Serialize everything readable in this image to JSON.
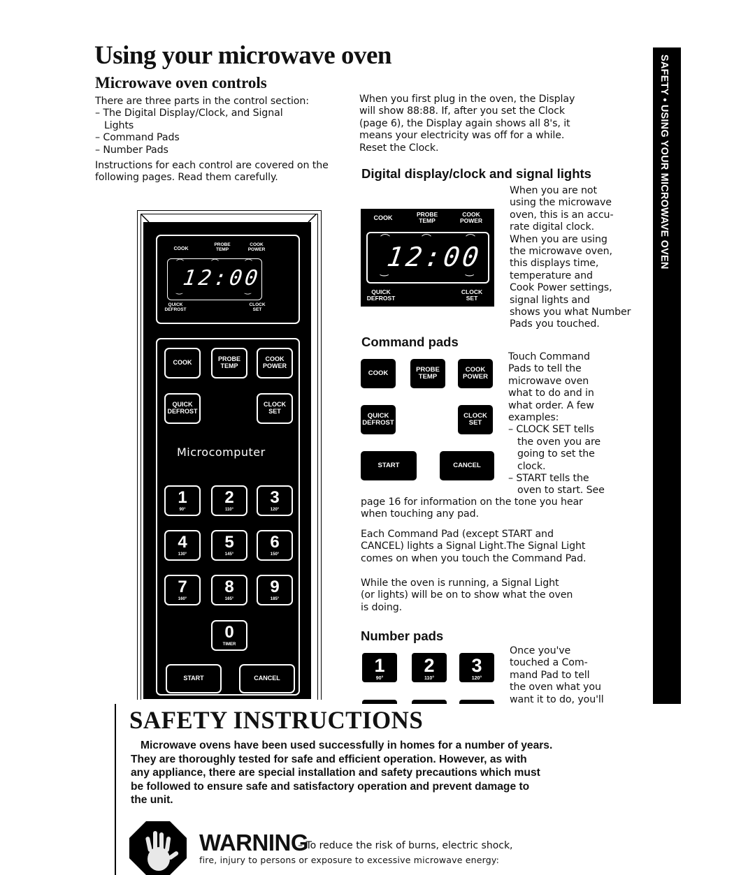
{
  "page": {
    "title": "Using your microwave oven",
    "subtitle": "Microwave oven controls",
    "side_banner": "SAFETY • USING YOUR MICROWAVE OVEN"
  },
  "intro": {
    "lead": "There are three parts in the control section:",
    "items": [
      "– The Digital Display/Clock, and Signal",
      "Lights",
      "– Command Pads",
      "– Number Pads"
    ],
    "instructions": [
      "Instructions for each control are covered on the",
      "following pages. Read them carefully."
    ]
  },
  "plug_text": [
    "When you first plug in the oven, the Display",
    "will show 88:88. If, after you set the Clock",
    "(page 6), the Display again shows all 8's, it",
    "means your electricity was off for a while.",
    "Reset the Clock."
  ],
  "digital_section": {
    "heading": "Digital display/clock and signal lights",
    "text": [
      "When you are not",
      "using the microwave",
      "oven, this is an accu-",
      "rate digital clock.",
      "When you are using",
      "the microwave oven,",
      "this displays time,",
      "temperature and",
      "Cook Power settings,",
      "signal lights and",
      "shows you what Number",
      "Pads you touched."
    ]
  },
  "display": {
    "top_labels": [
      "COOK",
      "PROBE TEMP",
      "COOK POWER"
    ],
    "bottom_labels": [
      "QUICK DEFROST",
      "CLOCK SET"
    ],
    "time": "12:00"
  },
  "command_section": {
    "heading": "Command pads",
    "pads": [
      "COOK",
      "PROBE TEMP",
      "COOK POWER",
      "QUICK DEFROST",
      "CLOCK SET",
      "START",
      "CANCEL"
    ],
    "text": [
      "Touch Command",
      "Pads to tell the",
      "microwave oven",
      "what to do and in",
      "what order. A few",
      "examples:",
      "– CLOCK SET tells",
      "the oven you are",
      "going to set the",
      "clock.",
      "– START tells the",
      "oven to start. See"
    ],
    "tail": [
      "page 16 for information on the tone you hear",
      "when touching any pad."
    ],
    "each": [
      "Each Command Pad (except START and",
      "CANCEL) lights a Signal Light.The Signal Light",
      "comes on when you touch the Command Pad."
    ],
    "while": [
      "While the oven is running, a Signal Light",
      "(or lights) will be on to show what the oven",
      "is doing."
    ]
  },
  "number_section": {
    "heading": "Number pads",
    "pads": [
      {
        "num": "1",
        "temp": "90°"
      },
      {
        "num": "2",
        "temp": "110°"
      },
      {
        "num": "3",
        "temp": "120°"
      }
    ],
    "text": [
      "Once you've",
      "touched a Com-",
      "mand Pad to tell",
      "the oven what you",
      "want it to do, you'll"
    ]
  },
  "panel": {
    "microcomputer_label": "Microcomputer",
    "number_pads": [
      {
        "num": "1",
        "temp": "90°"
      },
      {
        "num": "2",
        "temp": "110°"
      },
      {
        "num": "3",
        "temp": "120°"
      },
      {
        "num": "4",
        "temp": "130°"
      },
      {
        "num": "5",
        "temp": "145°"
      },
      {
        "num": "6",
        "temp": "150°"
      },
      {
        "num": "7",
        "temp": "160°"
      },
      {
        "num": "8",
        "temp": "165°"
      },
      {
        "num": "9",
        "temp": "185°"
      },
      {
        "num": "0",
        "temp": "TIMER"
      }
    ],
    "start": "START",
    "cancel": "CANCEL"
  },
  "safety": {
    "title": "SAFETY INSTRUCTIONS",
    "para": [
      "Microwave ovens have been used successfully in homes for a number of years.",
      "They are thoroughly tested for safe and efficient operation. However, as with",
      "any appliance, there are special installation and safety precautions which must",
      "be followed to ensure safe and satisfactory operation and prevent damage to",
      "the unit."
    ],
    "warning_title": "WARNING",
    "warning_line1": "– To reduce the risk of burns, electric shock,",
    "warning_line2": "fire, injury to persons or exposure to excessive microwave energy:"
  }
}
